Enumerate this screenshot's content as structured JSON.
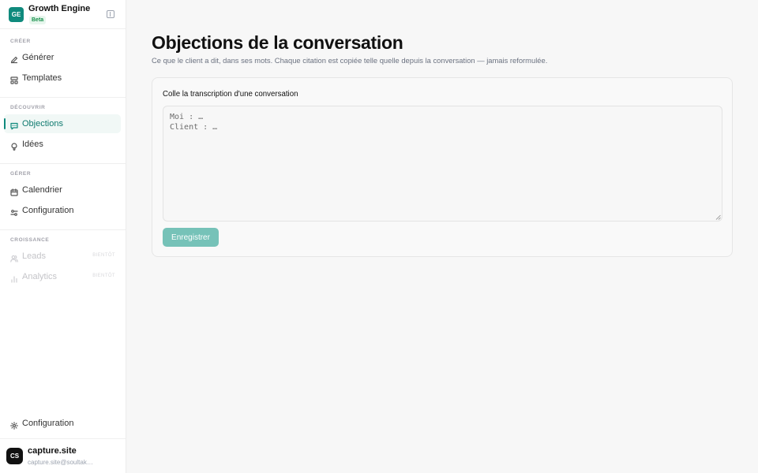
{
  "brand": {
    "logo_text": "GE",
    "name": "Growth Engine",
    "badge": "Beta",
    "accent_color": "#0f8a7d"
  },
  "sidebar": {
    "groups": [
      {
        "label": "CRÉER",
        "items": [
          {
            "label": "Générer",
            "icon": "pencil-icon"
          },
          {
            "label": "Templates",
            "icon": "template-icon"
          }
        ]
      },
      {
        "label": "DÉCOUVRIR",
        "items": [
          {
            "label": "Objections",
            "icon": "message-square-icon",
            "active": true
          },
          {
            "label": "Idées",
            "icon": "lightbulb-icon"
          }
        ]
      },
      {
        "label": "GÉRER",
        "items": [
          {
            "label": "Calendrier",
            "icon": "calendar-icon"
          },
          {
            "label": "Configuration",
            "icon": "sliders-icon"
          }
        ]
      },
      {
        "label": "CROISSANCE",
        "items": [
          {
            "label": "Leads",
            "icon": "users-icon",
            "disabled": true,
            "soon": "BIENTÔT"
          },
          {
            "label": "Analytics",
            "icon": "bar-chart-icon",
            "disabled": true,
            "soon": "BIENTÔT"
          }
        ]
      }
    ],
    "footer_item": {
      "label": "Configuration",
      "icon": "gear-icon"
    }
  },
  "user": {
    "initials": "CS",
    "name": "capture.site",
    "email": "capture.site@soultak…"
  },
  "main": {
    "title": "Objections de la conversation",
    "subtitle": "Ce que le client a dit, dans ses mots. Chaque citation est copiée telle quelle depuis la conversation — jamais reformulée.",
    "form": {
      "label": "Colle la transcription d'une conversation",
      "placeholder": "Moi : …\nClient : …",
      "value": "",
      "submit_label": "Enregistrer"
    }
  }
}
